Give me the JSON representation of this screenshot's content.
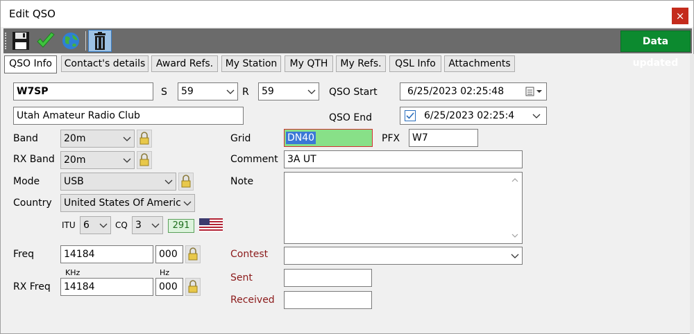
{
  "window": {
    "title": "Edit QSO",
    "close_glyph": "×"
  },
  "toolbar": {
    "icons": [
      "save-icon",
      "checkmark-icon",
      "globe-icon",
      "trash-icon"
    ],
    "status": "Data updated",
    "status_color": "#0c8a2f"
  },
  "tabs": [
    "QSO Info",
    "Contact's details",
    "Award Refs.",
    "My Station",
    "My QTH",
    "My Refs.",
    "QSL Info",
    "Attachments"
  ],
  "active_tab": "QSO Info",
  "form": {
    "call": "W7SP",
    "s_label": "S",
    "s_value": "59",
    "r_label": "R",
    "r_value": "59",
    "qso_start_label": "QSO Start",
    "qso_start": "6/25/2023 02:25:48",
    "qso_end_label": "QSO End",
    "qso_end": "6/25/2023 02:25:4",
    "qso_end_checked": true,
    "name": "Utah Amateur Radio Club",
    "band_label": "Band",
    "band": "20m",
    "rx_band_label": "RX Band",
    "rx_band": "20m",
    "mode_label": "Mode",
    "mode": "USB",
    "country_label": "Country",
    "country": "United States Of Americ",
    "itu_label": "ITU",
    "itu": "6",
    "cq_label": "CQ",
    "cq": "3",
    "dxcc": "291",
    "grid_label": "Grid",
    "grid": "DN40",
    "pfx_label": "PFX",
    "pfx": "W7",
    "comment_label": "Comment",
    "comment": "3A UT",
    "note_label": "Note",
    "note": "",
    "freq_label": "Freq",
    "freq_khz": "14184",
    "freq_hz": "000",
    "khz_label": "KHz",
    "hz_label": "Hz",
    "rx_freq_label": "RX Freq",
    "rx_freq_khz": "14184",
    "rx_freq_hz": "000",
    "contest_label": "Contest",
    "contest": "",
    "sent_label": "Sent",
    "sent": "",
    "received_label": "Received",
    "received": ""
  }
}
